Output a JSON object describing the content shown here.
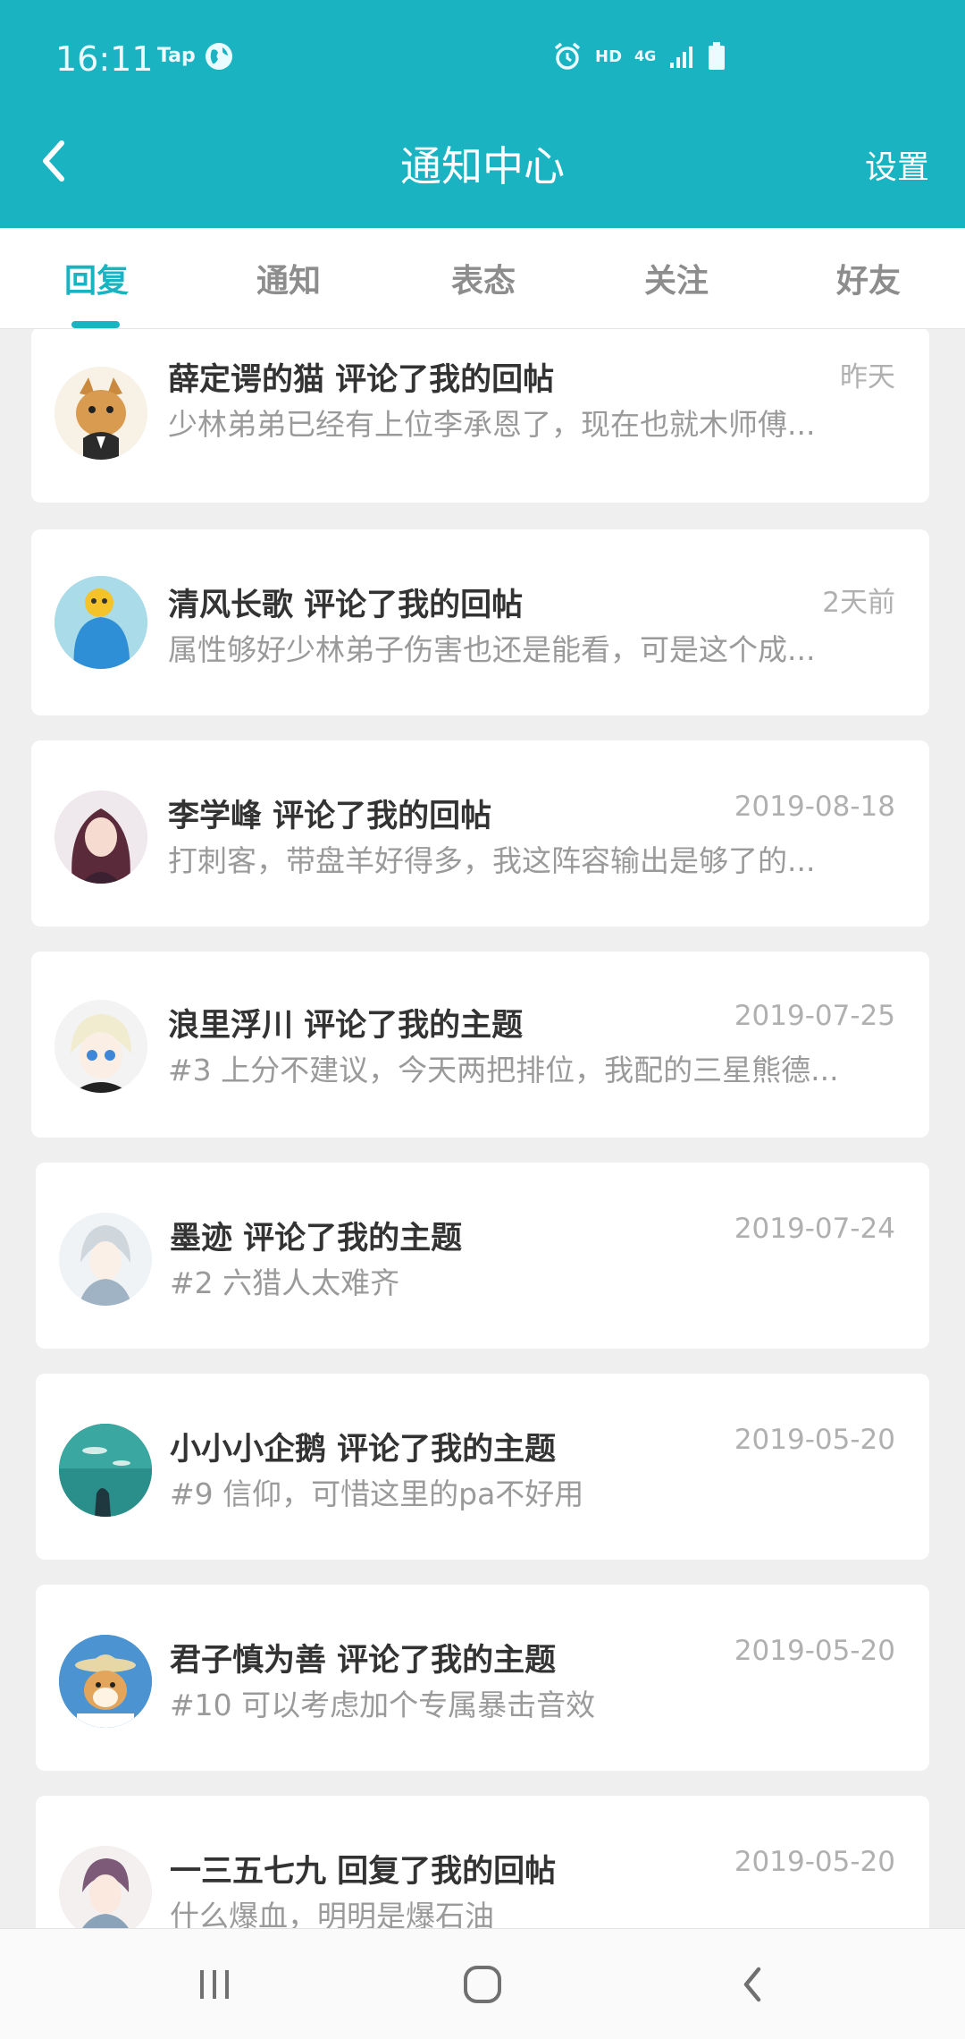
{
  "status_bar": {
    "time": "16:11",
    "app_label": "Tap",
    "hd": "HD",
    "network": "4G"
  },
  "header": {
    "title": "通知中心",
    "settings_label": "设置"
  },
  "tabs": [
    {
      "label": "回复",
      "active": true
    },
    {
      "label": "通知",
      "active": false
    },
    {
      "label": "表态",
      "active": false
    },
    {
      "label": "关注",
      "active": false
    },
    {
      "label": "好友",
      "active": false
    }
  ],
  "items": [
    {
      "title": "薛定谔的猫 评论了我的回帖",
      "preview": "少林弟弟已经有上位李承恩了，现在也就木师傅...",
      "time": "昨天"
    },
    {
      "title": "清风长歌 评论了我的回帖",
      "preview": "属性够好少林弟子伤害也还是能看，可是这个成...",
      "time": "2天前"
    },
    {
      "title": "李学峰 评论了我的回帖",
      "preview": "打刺客，带盘羊好得多，我这阵容输出是够了的...",
      "time": "2019-08-18"
    },
    {
      "title": "浪里浮川 评论了我的主题",
      "preview": "#3 上分不建议，今天两把排位，我配的三星熊德...",
      "time": "2019-07-25"
    },
    {
      "title": "墨迹 评论了我的主题",
      "preview": "#2 六猎人太难齐",
      "time": "2019-07-24"
    },
    {
      "title": "小小小企鹅 评论了我的主题",
      "preview": "#9 信仰，可惜这里的pa不好用",
      "time": "2019-05-20"
    },
    {
      "title": "君子慎为善 评论了我的主题",
      "preview": "#10 可以考虑加个专属暴击音效",
      "time": "2019-05-20"
    },
    {
      "title": "一三五七九 回复了我的回帖",
      "preview": "什么爆血，明明是爆石油",
      "time": "2019-05-20"
    }
  ],
  "colors": {
    "accent": "#1ab3c2",
    "title_text": "#333333",
    "muted_text": "#9a9a9a",
    "background": "#efefef"
  },
  "icons": {
    "back": "chevron-left-icon",
    "globe": "globe-icon",
    "alarm": "alarm-icon",
    "signal": "signal-icon",
    "battery": "battery-icon",
    "nav_recents": "recents-icon",
    "nav_home": "home-icon",
    "nav_back": "back-icon"
  }
}
